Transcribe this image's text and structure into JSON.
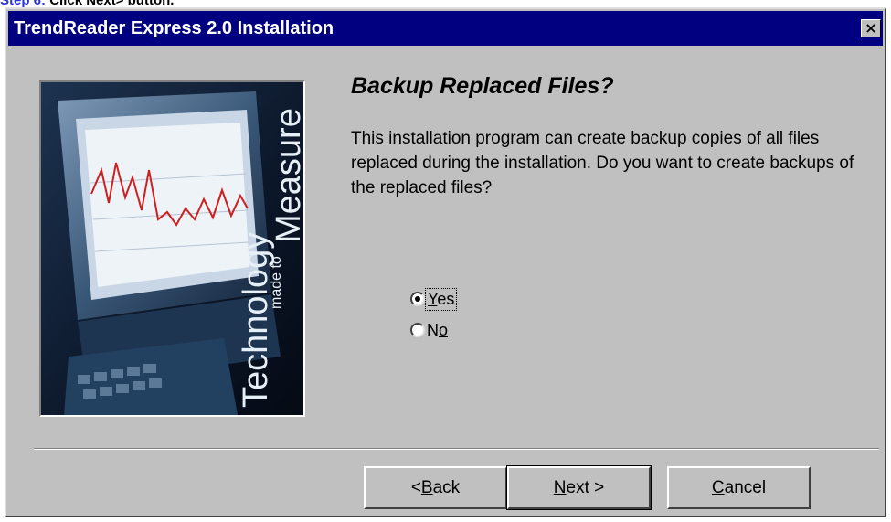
{
  "page_caption": {
    "step": "Step 6:",
    "rest": "Click Next> button."
  },
  "window": {
    "title": "TrendReader Express 2.0 Installation",
    "close_label": "×"
  },
  "splash": {
    "line1": "Technology",
    "line2": "made to",
    "line3": "Measure"
  },
  "content": {
    "heading": "Backup Replaced Files?",
    "body": "This installation program can create backup copies of all files replaced during the installation.  Do you want to create backups of the replaced files?"
  },
  "options": [
    {
      "label_pre": "",
      "label_u": "Y",
      "label_post": "es",
      "selected": true
    },
    {
      "label_pre": "N",
      "label_u": "o",
      "label_post": "",
      "selected": false
    }
  ],
  "buttons": {
    "back": {
      "pre": "< ",
      "u": "B",
      "post": "ack"
    },
    "next": {
      "pre": "",
      "u": "N",
      "post": "ext >"
    },
    "cancel": {
      "pre": "",
      "u": "C",
      "post": "ancel"
    }
  }
}
